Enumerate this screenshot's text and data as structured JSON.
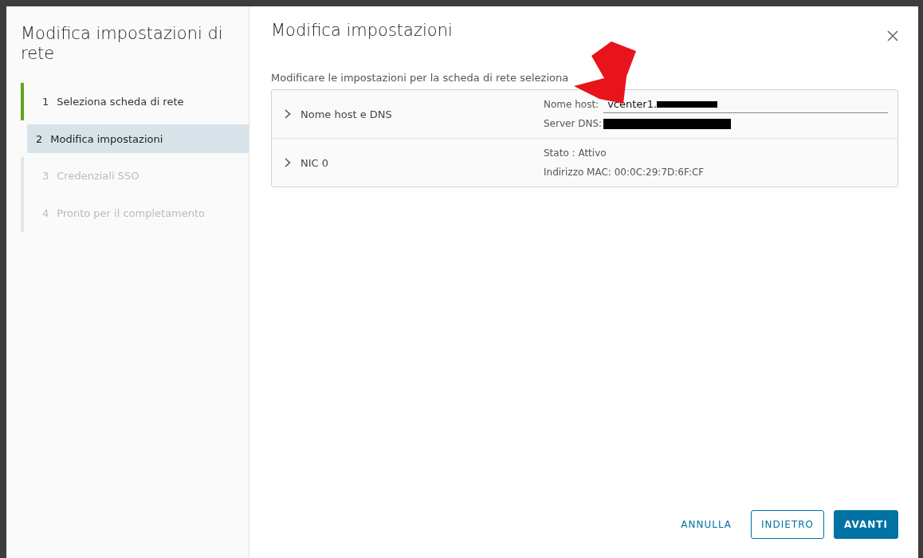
{
  "dialog": {
    "title": "Modifica impostazioni di rete"
  },
  "steps": [
    {
      "number": "1",
      "label": "Seleziona scheda di rete",
      "completed": true,
      "selected": false,
      "disabled": false
    },
    {
      "number": "2",
      "label": "Modifica impostazioni",
      "completed": false,
      "selected": true,
      "disabled": false
    },
    {
      "number": "3",
      "label": "Credenziali SSO",
      "completed": false,
      "selected": false,
      "disabled": true
    },
    {
      "number": "4",
      "label": "Pronto per il completamento",
      "completed": false,
      "selected": false,
      "disabled": true
    }
  ],
  "page": {
    "title": "Modifica impostazioni",
    "description": "Modificare le impostazioni per la scheda di rete seleziona"
  },
  "sections": [
    {
      "title": "Nome host e DNS",
      "expanded": false,
      "details": [
        {
          "kind": "input",
          "label": "Nome host:",
          "value": "vcenter1.",
          "redacted": true
        },
        {
          "kind": "text",
          "label": "Server DNS:",
          "redacted": true
        }
      ]
    },
    {
      "title": "NIC 0",
      "expanded": false,
      "details": [
        {
          "kind": "text",
          "label": "Stato : Attivo"
        },
        {
          "kind": "text",
          "label": "Indirizzo MAC: 00:0C:29:7D:6F:CF"
        }
      ]
    }
  ],
  "buttons": [
    {
      "label": "ANNULLA",
      "kind": "link"
    },
    {
      "label": "INDIETRO",
      "kind": "outline"
    },
    {
      "label": "AVANTI",
      "kind": "primary"
    }
  ]
}
